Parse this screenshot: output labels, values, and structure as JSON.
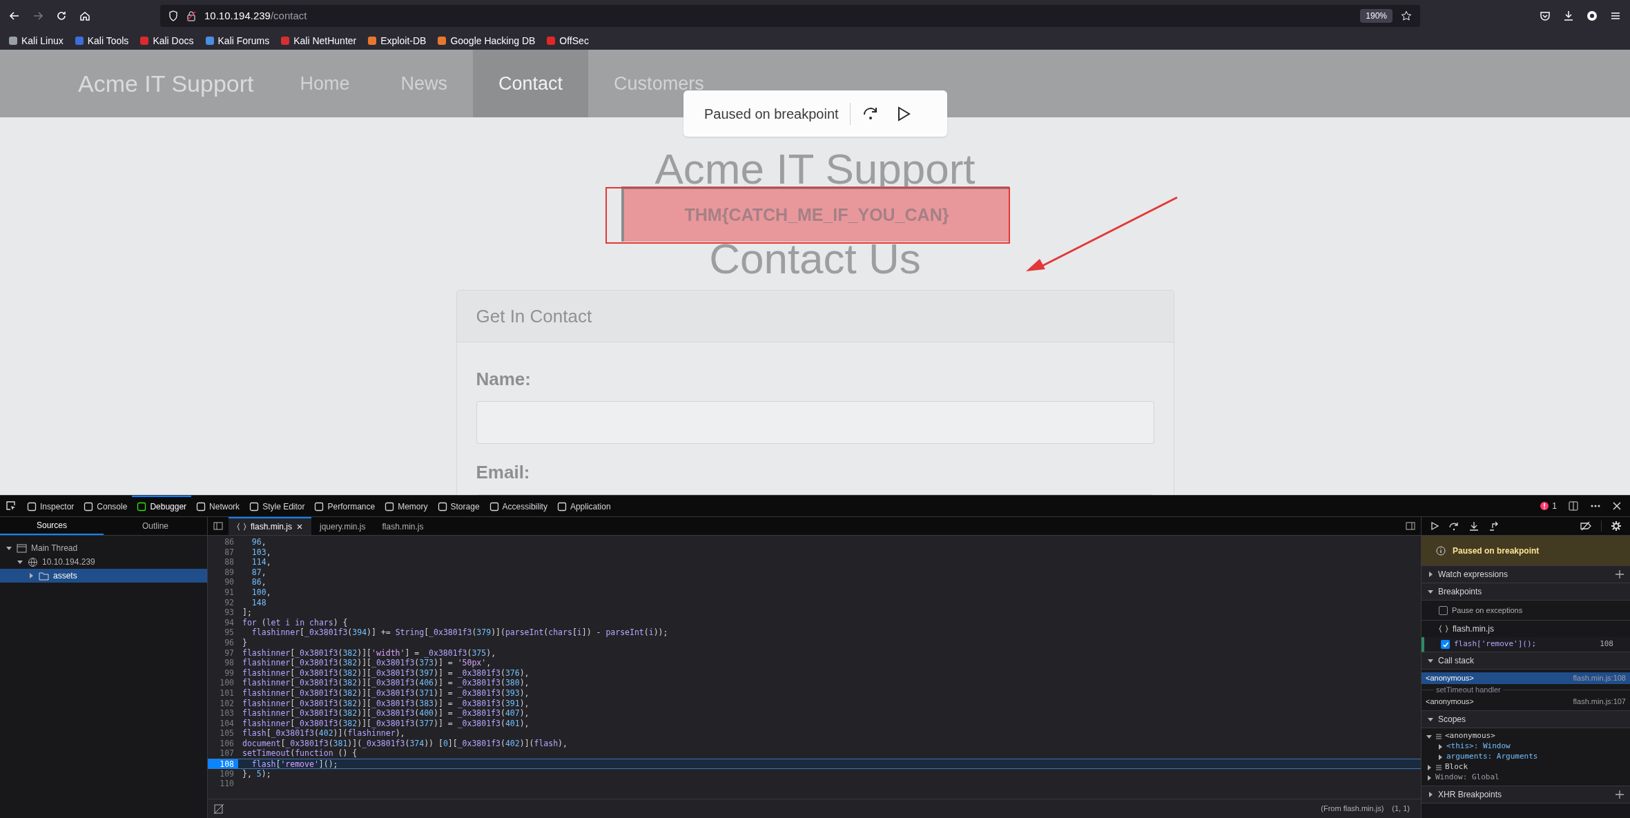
{
  "browser": {
    "url_host": "10.10.194.239",
    "url_path": "/contact",
    "zoom": "190%"
  },
  "bookmarks": [
    {
      "label": "Kali Linux",
      "color": "#9aa0a6"
    },
    {
      "label": "Kali Tools",
      "color": "#3d6fd9"
    },
    {
      "label": "Kali Docs",
      "color": "#d92b2b"
    },
    {
      "label": "Kali Forums",
      "color": "#4a8fe0"
    },
    {
      "label": "Kali NetHunter",
      "color": "#d33030"
    },
    {
      "label": "Exploit-DB",
      "color": "#e8772e"
    },
    {
      "label": "Google Hacking DB",
      "color": "#e8772e"
    },
    {
      "label": "OffSec",
      "color": "#e02828"
    }
  ],
  "site": {
    "brand": "Acme IT Support",
    "nav": [
      {
        "label": "Home",
        "selected": false
      },
      {
        "label": "News",
        "selected": false
      },
      {
        "label": "Contact",
        "selected": true
      },
      {
        "label": "Customers",
        "selected": false
      }
    ],
    "heading": "Acme IT Support",
    "flash": "THM{CATCH_ME_IF_YOU_CAN}",
    "subheading": "Contact Us",
    "card": {
      "title": "Get In Contact",
      "fields": [
        {
          "label": "Name:"
        },
        {
          "label": "Email:"
        }
      ]
    }
  },
  "pause_overlay": {
    "label": "Paused on breakpoint"
  },
  "devtools": {
    "tabs": [
      {
        "label": "Inspector",
        "selected": false
      },
      {
        "label": "Console",
        "selected": false
      },
      {
        "label": "Debugger",
        "selected": true
      },
      {
        "label": "Network",
        "selected": false
      },
      {
        "label": "Style Editor",
        "selected": false
      },
      {
        "label": "Performance",
        "selected": false
      },
      {
        "label": "Memory",
        "selected": false
      },
      {
        "label": "Storage",
        "selected": false
      },
      {
        "label": "Accessibility",
        "selected": false
      },
      {
        "label": "Application",
        "selected": false
      }
    ],
    "error_count": "1",
    "left_tabs": [
      {
        "label": "Sources",
        "selected": true
      },
      {
        "label": "Outline",
        "selected": false
      }
    ],
    "tree": [
      {
        "label": "Main Thread",
        "kind": "thread",
        "expanded": true,
        "selected": false,
        "children": [
          {
            "label": "10.10.194.239",
            "kind": "host",
            "expanded": true,
            "selected": false,
            "children": [
              {
                "label": "assets",
                "kind": "folder",
                "expanded": false,
                "selected": true
              }
            ]
          }
        ]
      }
    ],
    "file_tabs": [
      {
        "label": "flash.min.js",
        "selected": true,
        "pretty": true
      },
      {
        "label": "jquery.min.js",
        "selected": false,
        "pretty": false
      },
      {
        "label": "flash.min.js",
        "selected": false,
        "pretty": false
      }
    ],
    "code": [
      {
        "number": "86",
        "text": "  96,",
        "breakpoint": false
      },
      {
        "number": "87",
        "text": "  103,",
        "breakpoint": false
      },
      {
        "number": "88",
        "text": "  114,",
        "breakpoint": false
      },
      {
        "number": "89",
        "text": "  87,",
        "breakpoint": false
      },
      {
        "number": "90",
        "text": "  86,",
        "breakpoint": false
      },
      {
        "number": "91",
        "text": "  100,",
        "breakpoint": false
      },
      {
        "number": "92",
        "text": "  148",
        "breakpoint": false
      },
      {
        "number": "93",
        "text": "];",
        "breakpoint": false
      },
      {
        "number": "94",
        "text": "for (let i in chars) {",
        "breakpoint": false
      },
      {
        "number": "95",
        "text": "  flashinner[_0x3801f3(394)] += String[_0x3801f3(379)](parseInt(chars[i]) - parseInt(i));",
        "breakpoint": false
      },
      {
        "number": "96",
        "text": "}",
        "breakpoint": false
      },
      {
        "number": "97",
        "text": "flashinner[_0x3801f3(382)]['width'] = _0x3801f3(375),",
        "breakpoint": false
      },
      {
        "number": "98",
        "text": "flashinner[_0x3801f3(382)][_0x3801f3(373)] = '50px',",
        "breakpoint": false
      },
      {
        "number": "99",
        "text": "flashinner[_0x3801f3(382)][_0x3801f3(397)] = _0x3801f3(376),",
        "breakpoint": false
      },
      {
        "number": "100",
        "text": "flashinner[_0x3801f3(382)][_0x3801f3(406)] = _0x3801f3(380),",
        "breakpoint": false
      },
      {
        "number": "101",
        "text": "flashinner[_0x3801f3(382)][_0x3801f3(371)] = _0x3801f3(393),",
        "breakpoint": false
      },
      {
        "number": "102",
        "text": "flashinner[_0x3801f3(382)][_0x3801f3(383)] = _0x3801f3(391),",
        "breakpoint": false
      },
      {
        "number": "103",
        "text": "flashinner[_0x3801f3(382)][_0x3801f3(400)] = _0x3801f3(407),",
        "breakpoint": false
      },
      {
        "number": "104",
        "text": "flashinner[_0x3801f3(382)][_0x3801f3(377)] = _0x3801f3(401),",
        "breakpoint": false
      },
      {
        "number": "105",
        "text": "flash[_0x3801f3(402)](flashinner),",
        "breakpoint": false
      },
      {
        "number": "106",
        "text": "document[_0x3801f3(381)](_0x3801f3(374)) [0][_0x3801f3(402)](flash),",
        "breakpoint": false
      },
      {
        "number": "107",
        "text": "setTimeout(function () {",
        "breakpoint": false
      },
      {
        "number": "108",
        "text": "  flash['remove']();",
        "breakpoint": true
      },
      {
        "number": "109",
        "text": "}, 5);",
        "breakpoint": false
      },
      {
        "number": "110",
        "breakpoint": false
      }
    ],
    "status": {
      "source": "(From flash.min.js)",
      "position": "(1, 1)"
    },
    "paused_banner": "Paused on breakpoint",
    "watch": {
      "title": "Watch expressions",
      "expanded": false
    },
    "breakpoints": {
      "title": "Breakpoints",
      "expanded": true,
      "pause_on_exceptions": {
        "label": "Pause on exceptions",
        "checked": false
      },
      "files": [
        {
          "name": "flash.min.js",
          "items": [
            {
              "code": "flash['remove']();",
              "line": "108",
              "checked": true
            }
          ]
        }
      ]
    },
    "call_stack": {
      "title": "Call stack",
      "expanded": true,
      "frames": [
        {
          "kind": "frame",
          "name": "<anonymous>",
          "location": "flash.min.js:108",
          "selected": true
        },
        {
          "kind": "async",
          "name": "setTimeout handler"
        },
        {
          "kind": "frame",
          "name": "<anonymous>",
          "location": "flash.min.js:107",
          "selected": false
        }
      ]
    },
    "scopes": {
      "title": "Scopes",
      "expanded": true,
      "tree": [
        {
          "label": "<anonymous>",
          "kind": "scope",
          "expanded": true,
          "children": [
            {
              "label": "<this>: Window",
              "kind": "variable",
              "expanded": false
            },
            {
              "label": "arguments: Arguments",
              "kind": "variable",
              "expanded": false
            }
          ]
        },
        {
          "label": "Block",
          "kind": "scope",
          "expanded": false
        },
        {
          "label": "Window: Global",
          "kind": "global",
          "expanded": false
        }
      ]
    },
    "xhr": {
      "title": "XHR Breakpoints",
      "expanded": false
    }
  }
}
